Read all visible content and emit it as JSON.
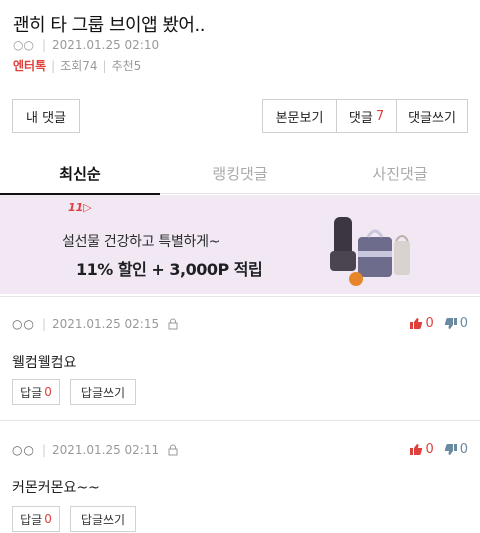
{
  "post": {
    "title": "괜히 타 그룹 브이앱 봤어..",
    "author": "○○",
    "datetime": "2021.01.25 02:10",
    "category": "엔터톡",
    "views": "조회74",
    "recommends": "추천5"
  },
  "actions": {
    "my_comments": "내 댓글",
    "view_post": "본문보기",
    "comments_label": "댓글",
    "comments_count": "7",
    "write_comment": "댓글쓰기"
  },
  "tabs": [
    {
      "label": "최신순",
      "active": true
    },
    {
      "label": "랭킹댓글",
      "active": false
    },
    {
      "label": "사진댓글",
      "active": false
    }
  ],
  "banner": {
    "logo": "11▷",
    "line1": "설선물 건강하고 특별하게~",
    "line2": "11% 할인 + 3,000P 적립"
  },
  "comments": [
    {
      "author": "○○",
      "datetime": "2021.01.25 02:15",
      "up": "0",
      "down": "0",
      "text": "웰컴웰컴요",
      "reply_label": "답글",
      "reply_count": "0",
      "write_reply": "답글쓰기"
    },
    {
      "author": "○○",
      "datetime": "2021.01.25 02:11",
      "up": "0",
      "down": "0",
      "text": "커몬커몬요~~",
      "reply_label": "답글",
      "reply_count": "0",
      "write_reply": "답글쓰기"
    }
  ],
  "colors": {
    "accent_red": "#e0403c",
    "banner_bg": "#f1e8f3",
    "down_blue": "#6a8aa0"
  }
}
